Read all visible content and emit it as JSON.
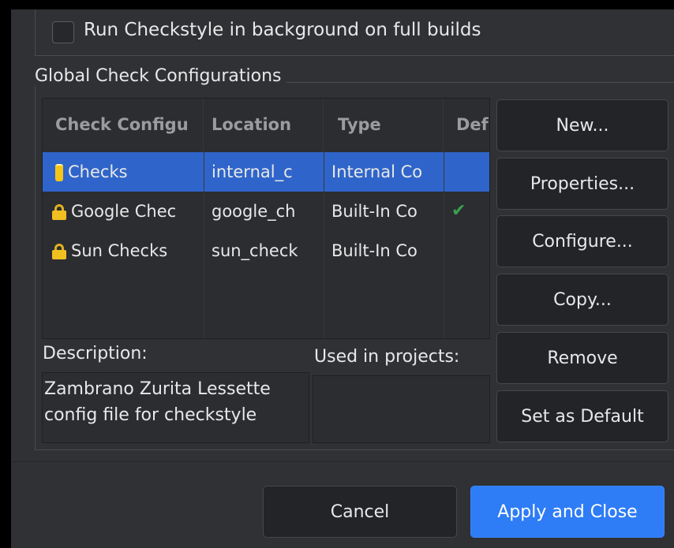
{
  "background_checkbox": {
    "label": "Run Checkstyle in background on full builds",
    "checked": false
  },
  "global": {
    "title": "Global Check Configurations",
    "columns": [
      "Check Configu",
      "Location",
      "Type",
      "Def"
    ],
    "rows": [
      {
        "name": "Checks",
        "location": "internal_c",
        "type": "Internal Co",
        "default": "",
        "icon": "database-icon",
        "selected": true
      },
      {
        "name": "Google Chec",
        "location": "google_ch",
        "type": "Built-In Co",
        "default": "✔",
        "icon": "lock-icon",
        "selected": false
      },
      {
        "name": "Sun Checks",
        "location": "sun_check",
        "type": "Built-In Co",
        "default": "",
        "icon": "lock-icon",
        "selected": false
      }
    ],
    "buttons": {
      "new": "New...",
      "properties": "Properties...",
      "configure": "Configure...",
      "copy": "Copy...",
      "remove": "Remove",
      "set_default": "Set as Default"
    },
    "description_label": "Description:",
    "description_text": "Zambrano Zurita Lessette config file for checkstyle",
    "used_label": "Used in projects:"
  },
  "dialog_buttons": {
    "cancel": "Cancel",
    "apply_close": "Apply and Close"
  },
  "colors": {
    "selection": "#2f65ca",
    "primary_button": "#2e7cf6",
    "default_check": "#3aa14a"
  }
}
